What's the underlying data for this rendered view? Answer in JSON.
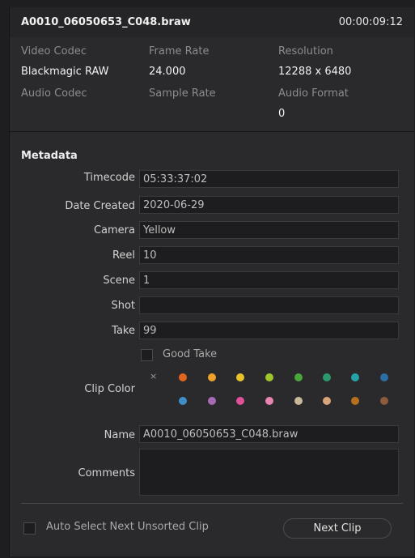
{
  "clip": {
    "name": "A0010_06050653_C048.braw",
    "duration": "00:00:09:12"
  },
  "info": {
    "video_codec_label": "Video Codec",
    "video_codec_value": "Blackmagic RAW",
    "frame_rate_label": "Frame Rate",
    "frame_rate_value": "24.000",
    "resolution_label": "Resolution",
    "resolution_value": "12288 x 6480",
    "audio_codec_label": "Audio Codec",
    "sample_rate_label": "Sample Rate",
    "audio_format_label": "Audio Format",
    "audio_format_value": "0"
  },
  "metadata": {
    "title": "Metadata",
    "timecode_label": "Timecode",
    "timecode_value": "05:33:37:02",
    "date_created_label": "Date Created",
    "date_created_value": "2020-06-29",
    "camera_label": "Camera",
    "camera_value": "Yellow",
    "reel_label": "Reel",
    "reel_value": "10",
    "scene_label": "Scene",
    "scene_value": "1",
    "shot_label": "Shot",
    "shot_value": "",
    "take_label": "Take",
    "take_value": "99",
    "good_take_label": "Good Take",
    "good_take_checked": false,
    "clip_color_label": "Clip Color",
    "clip_color_none_glyph": "×",
    "clip_colors_row1": [
      "#e2641f",
      "#efa12a",
      "#e8c22a",
      "#9fc52d",
      "#4aa53a",
      "#2a9a6e",
      "#23a3a8",
      "#2a6ea3"
    ],
    "clip_colors_row2": [
      "#3f8fc7",
      "#a56bb5",
      "#e0519a",
      "#e884b0",
      "#c8b89a",
      "#d8a47a",
      "#b4701f",
      "#8d5a3c"
    ],
    "name_label": "Name",
    "name_value": "A0010_06050653_C048.braw",
    "comments_label": "Comments",
    "comments_value": ""
  },
  "footer": {
    "auto_select_label": "Auto Select Next Unsorted Clip",
    "auto_select_checked": false,
    "next_clip_label": "Next Clip"
  }
}
